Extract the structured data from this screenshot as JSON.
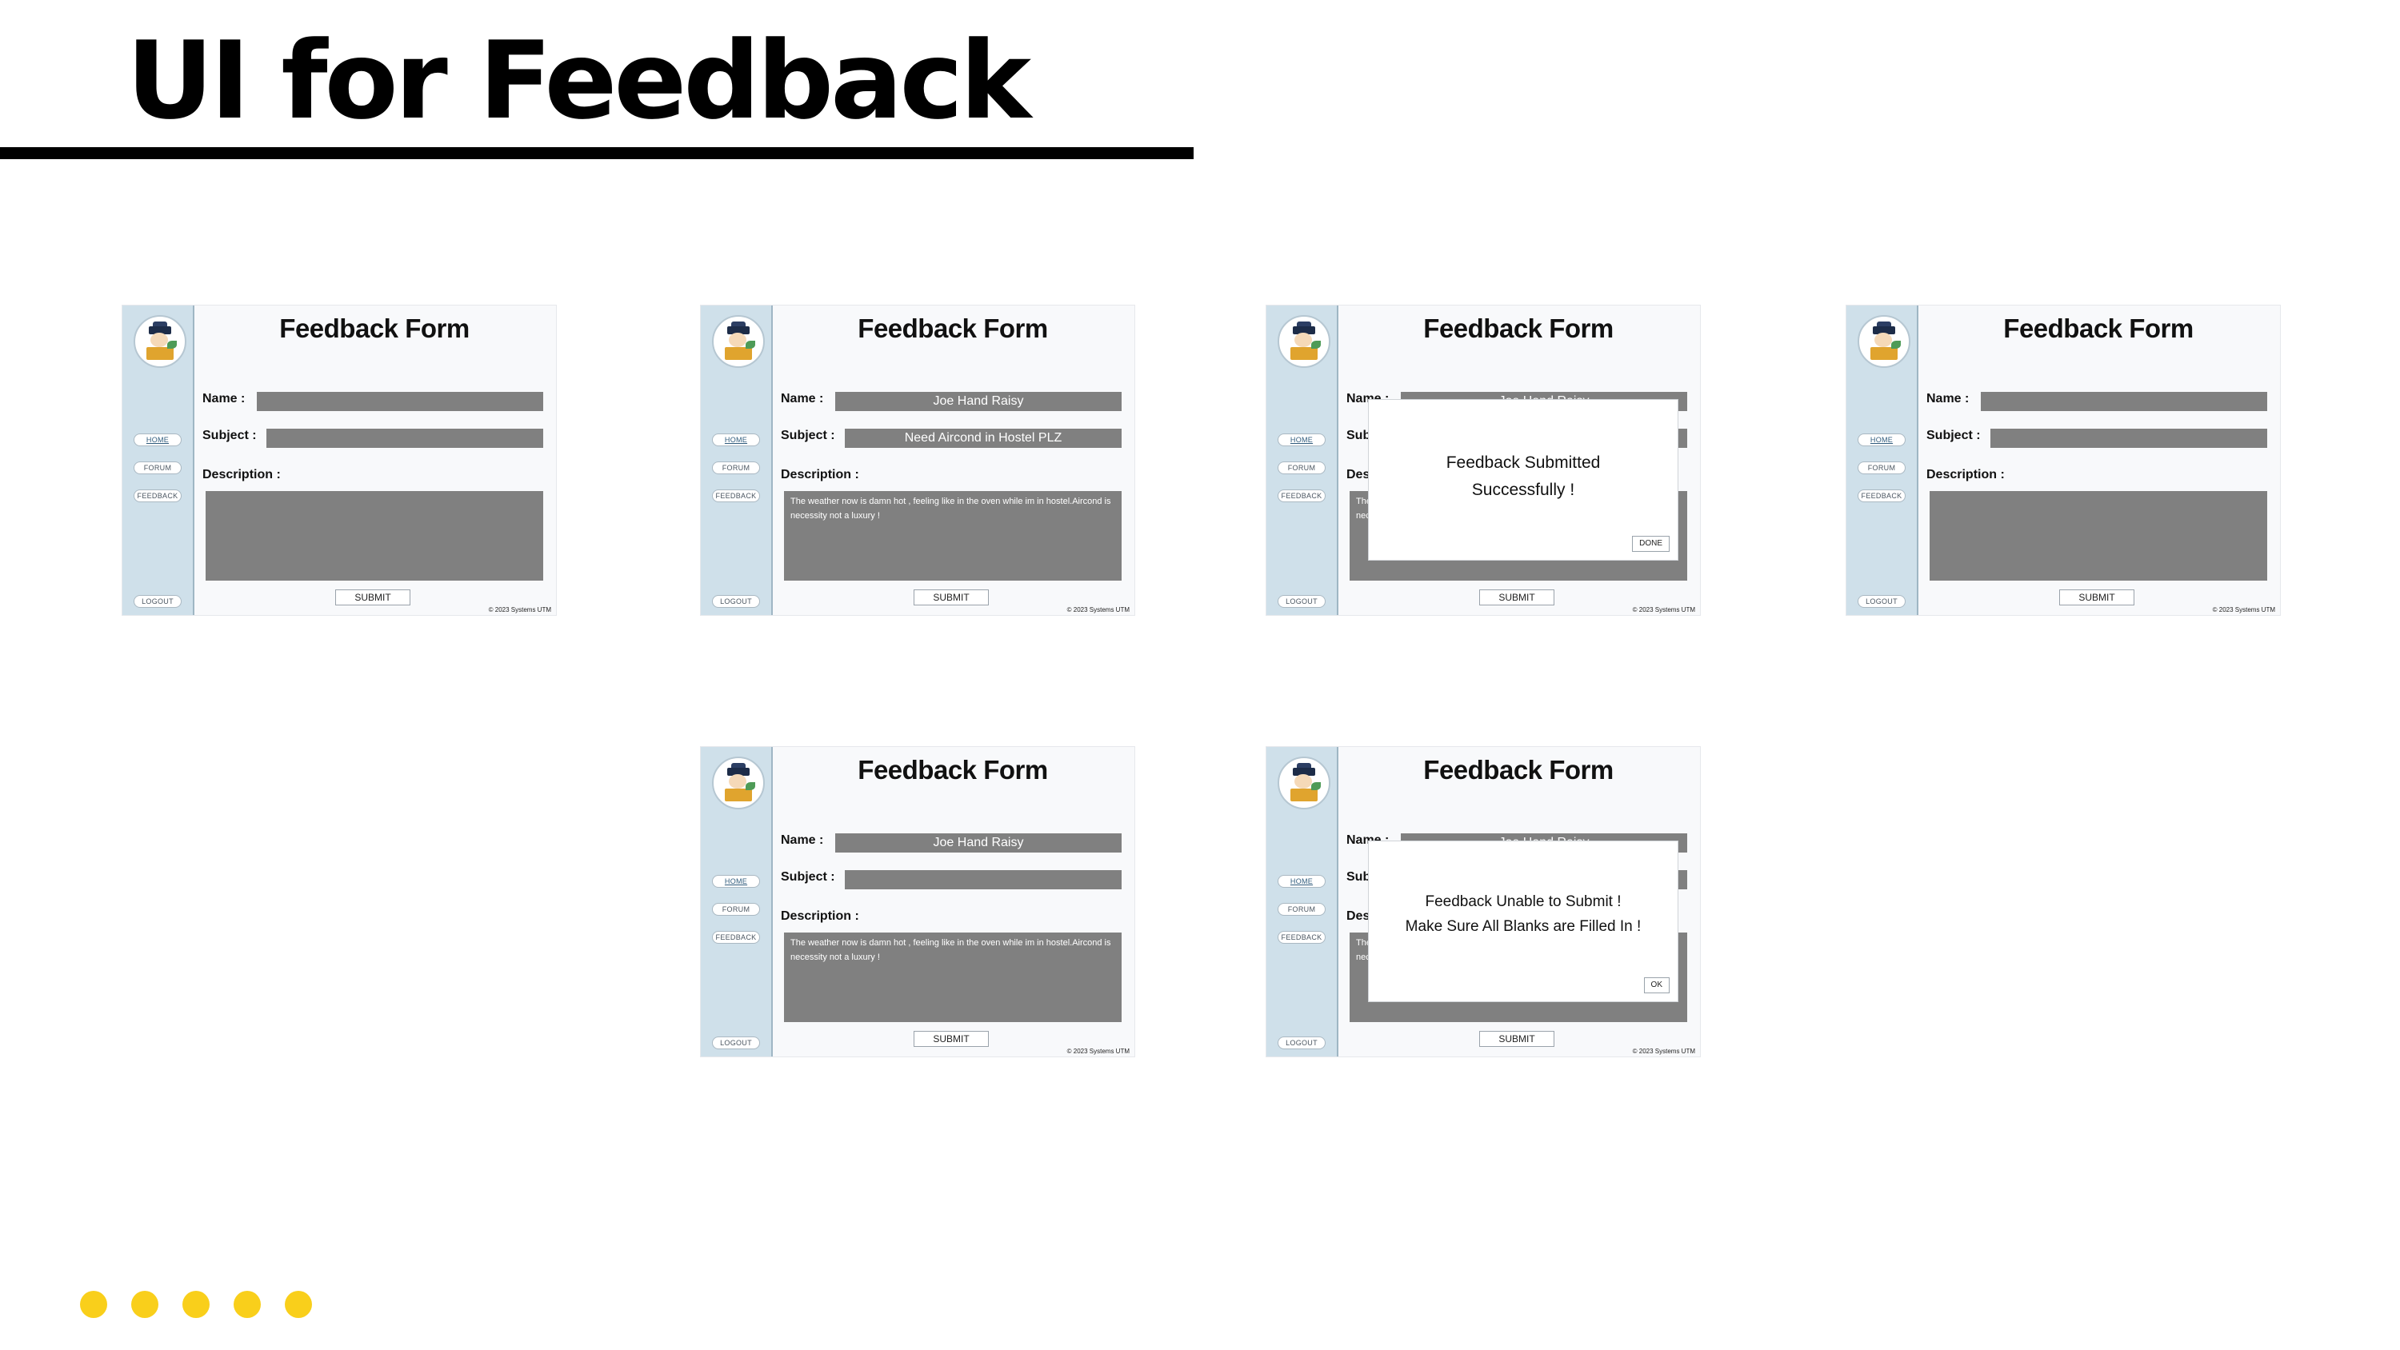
{
  "slide": {
    "title": "UI for Feedback",
    "dot_color": "#f9cf1b",
    "dots": 5
  },
  "app": {
    "form_title": "Feedback Form",
    "labels": {
      "name": "Name :",
      "subject": "Subject :",
      "description": "Description :"
    },
    "nav": [
      "HOME",
      "FORUM",
      "FEEDBACK"
    ],
    "logout": "LOGOUT",
    "submit": "SUBMIT",
    "footer": "© 2023 Systems UTM",
    "colors": {
      "sidebar": "#cfe0ea",
      "field": "#808080",
      "page": "#f8f9fb"
    }
  },
  "screens": [
    {
      "id": "empty",
      "name": "",
      "subject": "",
      "description": "",
      "dialog": null
    },
    {
      "id": "filled",
      "name": "Joe Hand Raisy",
      "subject": "Need Aircond in Hostel PLZ",
      "description": "The weather now is damn hot , feeling like in the oven while im in hostel.Aircond is necessity not a luxury !",
      "dialog": null
    },
    {
      "id": "success",
      "name": "Joe Hand Raisy",
      "subject": "",
      "description": "The weather now is damn hot , feeling like in the oven while im in hostel.Aircond is necessity not a luxury !",
      "dialog": {
        "message": "Feedback Submitted\nSuccessfully !",
        "button": "DONE"
      }
    },
    {
      "id": "reset",
      "name": "",
      "subject": "",
      "description": "",
      "dialog": null
    },
    {
      "id": "missing-subject",
      "name": "Joe Hand Raisy",
      "subject": "",
      "description": "The weather now is damn hot , feeling like in the oven while im in hostel.Aircond is necessity not a luxury !",
      "dialog": null
    },
    {
      "id": "error",
      "name": "Joe Hand Raisy",
      "subject": "",
      "description": "The weather now is damn hot , feeling like in the oven while im in hostel.Aircond is necessity not a luxury !",
      "dialog": {
        "message": "Feedback Unable to Submit !\nMake Sure All Blanks are Filled In !",
        "button": "OK"
      }
    }
  ]
}
